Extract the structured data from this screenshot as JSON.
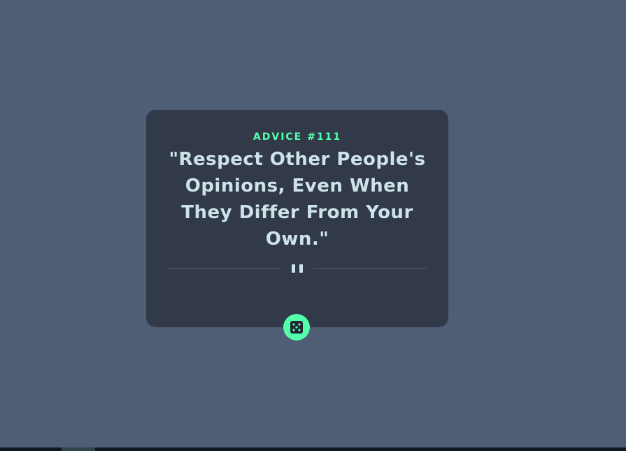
{
  "advice": {
    "label": "ADVICE #111",
    "quote": "\"Respect Other People's Opinions, Even When They Differ From Your Own.\""
  },
  "divider": {
    "icon": "pause-icon"
  },
  "dice_button": {
    "icon": "dice-icon"
  },
  "colors": {
    "background": "#4f5d75",
    "card": "#323a49",
    "accent": "#53ffaa",
    "text": "#cee3e9"
  }
}
